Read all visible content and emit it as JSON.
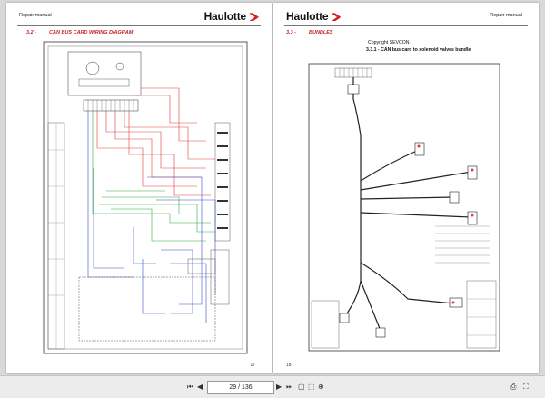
{
  "pages": [
    {
      "header_left": "Repair manual",
      "logo": "Haulotte",
      "section_number": "3.2 -",
      "section_title": "CAN BUS CARD WIRING DIAGRAM",
      "page_number": "17"
    },
    {
      "header_right": "Repair manual",
      "logo": "Haulotte",
      "section_number": "3.3 -",
      "section_title": "BUNDLES",
      "copyright": "Copyright SEVCON",
      "subsection": "3.3.1 - CAN bus card to solenoid valves bundle",
      "page_number": "18"
    }
  ],
  "toolbar": {
    "page_input": "29 / 136",
    "icons": [
      "first-page-icon",
      "prev-page-icon",
      "next-page-icon",
      "last-page-icon",
      "fit-page-icon",
      "fit-width-icon",
      "zoom-icon",
      "rotate-icon",
      "print-icon",
      "fullscreen-icon"
    ]
  },
  "colors": {
    "accent": "#cc1f1f",
    "wire_red": "#e23b3b",
    "wire_green": "#2fae3a",
    "wire_blue": "#3a4fc8"
  }
}
